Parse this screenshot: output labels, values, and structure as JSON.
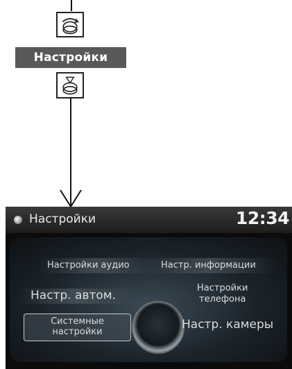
{
  "diagram": {
    "top_icon": "knob-rotate-icon",
    "label": "Настройки",
    "press_icon": "knob-press-icon"
  },
  "screen": {
    "title": "Настройки",
    "title_icon": "settings-gear-icon",
    "clock": "12:34",
    "menu": {
      "audio_settings": "Настройки аудио",
      "info_settings": "Настр. информации",
      "vehicle_settings": "Настр. автом.",
      "phone_settings_line1": "Настройки",
      "phone_settings_line2": "телефона",
      "system_settings_line1": "Системные",
      "system_settings_line2": "настройки",
      "camera_settings": "Настр. камеры"
    },
    "selected_item": "system_settings"
  }
}
